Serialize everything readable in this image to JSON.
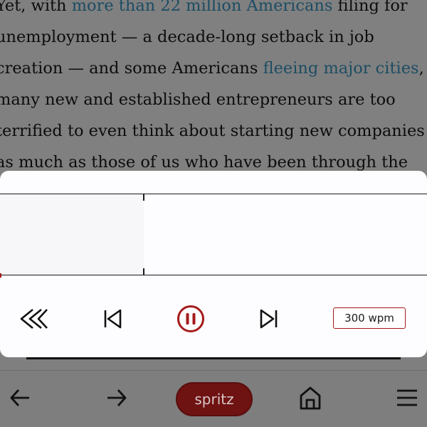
{
  "article": {
    "lines": [
      {
        "before": "Yet, with ",
        "link": "more than 22 million Americans",
        "after": " filing for"
      },
      {
        "before": "unemployment — a decade-long setback in job",
        "link": "",
        "after": ""
      },
      {
        "before": "creation — and some Americans ",
        "link": "fleeing major cities",
        "after": ","
      },
      {
        "before": "many new and established entrepreneurs are too",
        "link": "",
        "after": ""
      },
      {
        "before": "terrified to even think about starting new companies",
        "link": "",
        "after": ""
      },
      {
        "before": "as much as those of us who have been through the",
        "link": "",
        "after": ""
      }
    ]
  },
  "reader": {
    "current_word": "",
    "wpm_label": "300 wpm"
  },
  "controls": {
    "rewind_icon": "rewind-icon",
    "previous_icon": "skip-back-icon",
    "pause_icon": "pause-icon",
    "next_icon": "skip-forward-icon"
  },
  "nav": {
    "back_icon": "arrow-left-icon",
    "forward_icon": "arrow-right-icon",
    "spritz_label": "spritz",
    "home_icon": "home-icon",
    "menu_icon": "menu-icon"
  },
  "colors": {
    "accent": "#a41a1a",
    "spritz_button": "#6e1212",
    "link": "#1c4c63",
    "overlay": "#808080"
  }
}
